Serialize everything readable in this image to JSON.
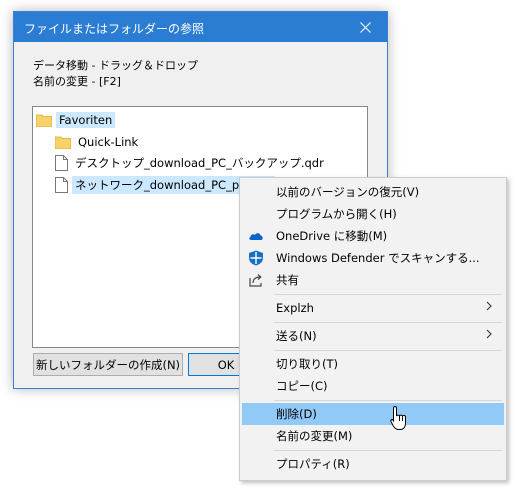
{
  "dialog": {
    "title": "ファイルまたはフォルダーの参照",
    "desc_line1": "データ移動 - ドラッグ＆ドロップ",
    "desc_line2": "名前の変更 - [F2]",
    "tree": {
      "root": "Favoriten",
      "children": [
        "Quick-Link",
        "デスクトップ_download_PC_バックアップ.qdr",
        "ネットワーク_download_PC_pic.qdr"
      ]
    },
    "new_folder_button": "新しいフォルダーの作成(N)",
    "ok_button": "OK"
  },
  "context_menu": {
    "items": [
      {
        "label": "以前のバージョンの復元(V)",
        "icon": ""
      },
      {
        "label": "プログラムから開く(H)",
        "icon": ""
      },
      {
        "label": "OneDrive に移動(M)",
        "icon": "onedrive-icon"
      },
      {
        "label": "Windows Defender でスキャンする...",
        "icon": "windows-defender-icon"
      },
      {
        "label": "共有",
        "icon": "share-icon"
      },
      {
        "label": "Explzh",
        "icon": "",
        "submenu": true
      },
      {
        "label": "送る(N)",
        "icon": "",
        "submenu": true
      },
      {
        "label": "切り取り(T)",
        "icon": ""
      },
      {
        "label": "コピー(C)",
        "icon": ""
      },
      {
        "label": "削除(D)",
        "icon": "",
        "highlighted": true
      },
      {
        "label": "名前の変更(M)",
        "icon": ""
      },
      {
        "label": "プロパティ(R)",
        "icon": ""
      }
    ]
  },
  "colors": {
    "titlebar": "#2b7cd3",
    "selection": "#cce8ff",
    "menu_highlight": "#91c9f7",
    "folder": "#f7d16a"
  }
}
